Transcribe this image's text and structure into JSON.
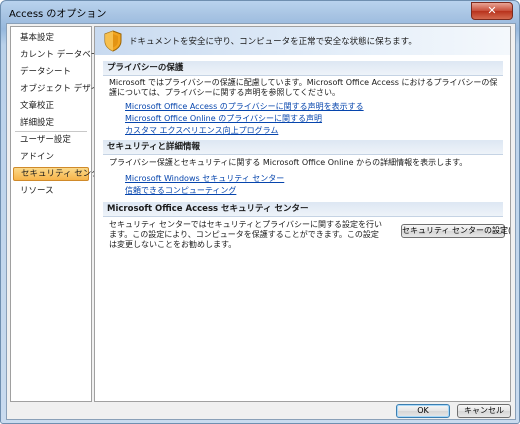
{
  "window": {
    "title": "Access のオプション",
    "close_label": "✕"
  },
  "sidebar": {
    "items": [
      {
        "label": "基本設定"
      },
      {
        "label": "カレント データベース"
      },
      {
        "label": "データシート"
      },
      {
        "label": "オブジェクト デザイナ"
      },
      {
        "label": "文章校正"
      },
      {
        "label": "詳細設定"
      },
      {
        "label": "ユーザー設定"
      },
      {
        "label": "アドイン"
      },
      {
        "label": "セキュリティ センター"
      },
      {
        "label": "リソース"
      }
    ],
    "selected": "セキュリティ センター"
  },
  "banner": {
    "text": "ドキュメントを安全に守り、コンピュータを正常で安全な状態に保ちます。"
  },
  "privacy": {
    "header": "プライバシーの保護",
    "text": "Microsoft ではプライバシーの保護に配慮しています。Microsoft Office Access におけるプライバシーの保護については、プライバシーに関する声明を参照してください。",
    "links": [
      "Microsoft Office Access のプライバシーに関する声明を表示する",
      "Microsoft Office Online のプライバシーに関する声明",
      "カスタマ エクスペリエンス向上プログラム"
    ]
  },
  "security": {
    "header": "セキュリティと詳細情報",
    "text": "プライバシー保護とセキュリティに関する Microsoft Office Online からの詳細情報を表示します。",
    "links": [
      "Microsoft Windows セキュリティ センター",
      "信頼できるコンピューティング"
    ]
  },
  "trust_center": {
    "header": "Microsoft Office Access セキュリティ センター",
    "text": "セキュリティ センターではセキュリティとプライバシーに関する設定を行います。この設定により、コンピュータを保護することができます。この設定は変更しないことをお勧めします。",
    "button": "セキュリティ センターの設定(T)..."
  },
  "footer": {
    "ok": "OK",
    "cancel": "キャンセル"
  },
  "colors": {
    "accent": "#f7b44a",
    "link": "#0645ad",
    "section_header": "#dde7f3"
  }
}
